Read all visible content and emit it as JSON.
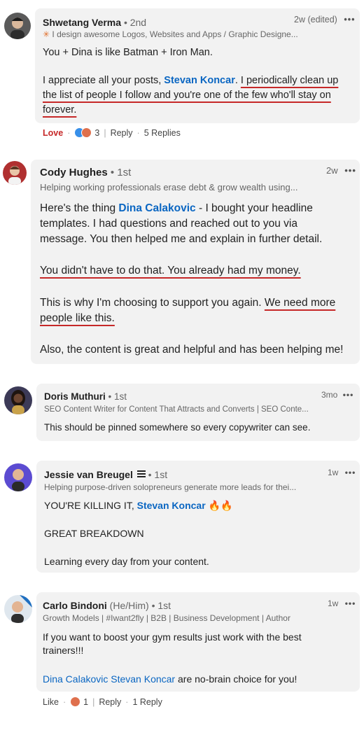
{
  "comments": [
    {
      "author": "Shwetang Verma",
      "degree": "• 2nd",
      "headline_prefix": "✳",
      "headline": "I design awesome Logos, Websites and Apps / Graphic Designe...",
      "time": "2w (edited)",
      "menu": "•••",
      "lines": [
        {
          "text": "You + Dina is like Batman + Iron Man."
        },
        {
          "pre": "I appreciate all your posts, ",
          "link": "Stevan Koncar",
          "mid": ". ",
          "hl": "I periodically clean up"
        },
        {
          "hl": "the list of people I follow and you're one of the few who'll stay on"
        },
        {
          "hl": "forever."
        }
      ],
      "actions": {
        "reaction": "Love",
        "count": "3",
        "reply": "Reply",
        "replies": "5 Replies"
      }
    },
    {
      "author": "Cody Hughes",
      "degree": "• 1st",
      "headline": "Helping working professionals erase debt & grow wealth using...",
      "time": "2w",
      "menu": "•••",
      "lines": [
        {
          "pre": "Here's the thing ",
          "link": "Dina Calakovic",
          "post": " - I bought your headline"
        },
        {
          "text": "templates. I had questions and reached out to you via"
        },
        {
          "text": "message. You then helped me and explain in further detail."
        },
        {
          "hl": "You didn't have to do that. You already had my money."
        },
        {
          "pre": "This is why I'm choosing to support you again. ",
          "hl": "We need more"
        },
        {
          "hl": "people like this."
        },
        {
          "text": "Also, the content is great and helpful and has been helping me!"
        }
      ]
    },
    {
      "author": "Doris Muthuri",
      "degree": "• 1st",
      "headline": "SEO Content Writer for Content That Attracts and Converts | SEO Conte...",
      "time": "3mo",
      "menu": "•••",
      "lines": [
        {
          "text": "This should be pinned somewhere so every copywriter can see."
        }
      ]
    },
    {
      "author": "Jessie van Breugel",
      "degree": "• 1st",
      "headline": "Helping purpose-driven solopreneurs generate more leads for thei...",
      "time": "1w",
      "menu": "•••",
      "lines": [
        {
          "pre": "YOU'RE KILLING IT, ",
          "link": "Stevan Koncar",
          "fire": "🔥🔥"
        },
        {
          "text": "GREAT BREAKDOWN"
        },
        {
          "text": "Learning every day from your content."
        }
      ]
    },
    {
      "author": "Carlo Bindoni",
      "pronouns": "(He/Him)",
      "degree": "• 1st",
      "headline": "Growth Models | #Iwant2fly | B2B | Business Development | Author",
      "time": "1w",
      "menu": "•••",
      "lines": [
        {
          "text": "If you want to boost your gym results just work with the best"
        },
        {
          "text": "trainers!!!"
        },
        {
          "link": "Dina Calakovic Stevan Koncar",
          "post": " are no-brain choice for you!"
        }
      ],
      "actions": {
        "reaction": "Like",
        "count": "1",
        "reply": "Reply",
        "replies": "1 Reply"
      }
    }
  ],
  "colors": {
    "link": "#0a66c2",
    "highlight": "#c62828",
    "bubble": "#f2f2f2"
  }
}
